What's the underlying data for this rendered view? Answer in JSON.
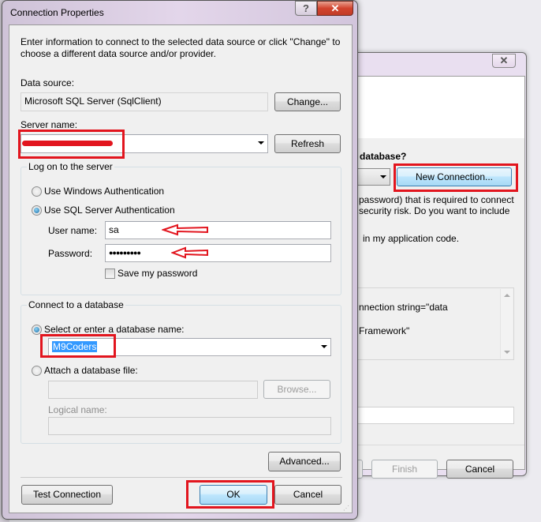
{
  "background_wizard": {
    "question_fragment": "database?",
    "new_connection_label": "New Connection...",
    "warning_line1": "password) that is required to connect",
    "warning_line2": "security risk. Do you want to include",
    "option_fragment": "in my application code.",
    "conn_string_line1": "nnection string=\"data",
    "conn_string_line2": "Framework\"",
    "finish_label": "Finish",
    "cancel_label": "Cancel",
    "close_glyph": "✕"
  },
  "dialog": {
    "title": "Connection Properties",
    "help_glyph": "?",
    "close_glyph": "✕",
    "intro": "Enter information to connect to the selected data source or click \"Change\" to choose a different data source and/or provider.",
    "data_source_label": "Data source:",
    "data_source_value": "Microsoft SQL Server (SqlClient)",
    "change_label": "Change...",
    "server_name_label": "Server name:",
    "server_name_value": "",
    "refresh_label": "Refresh",
    "logon": {
      "group_title": "Log on to the server",
      "windows_auth_label": "Use Windows Authentication",
      "windows_auth_selected": false,
      "sql_auth_label": "Use SQL Server Authentication",
      "sql_auth_selected": true,
      "username_label": "User name:",
      "username_value": "sa",
      "password_label": "Password:",
      "password_value": "●●●●●●●●●",
      "save_password_label": "Save my password",
      "save_password_checked": false
    },
    "database": {
      "group_title": "Connect to a database",
      "select_db_label": "Select or enter a database name:",
      "select_db_selected": true,
      "db_name_value": "M9Coders",
      "attach_label": "Attach a database file:",
      "attach_selected": false,
      "attach_file_value": "",
      "browse_label": "Browse...",
      "logical_name_label": "Logical name:",
      "logical_name_value": ""
    },
    "advanced_label": "Advanced...",
    "test_connection_label": "Test Connection",
    "ok_label": "OK",
    "cancel_label": "Cancel"
  },
  "annotations": {
    "highlight_color": "#e2151e"
  }
}
